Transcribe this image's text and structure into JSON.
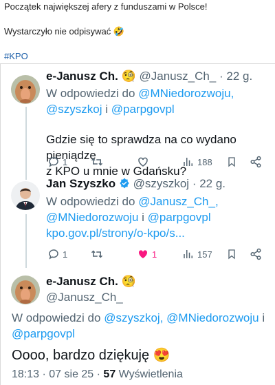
{
  "post": {
    "title": "Początek największej afery z funduszami w Polsce!",
    "line2": "Wystarczyło nie odpisywać",
    "emoji2": "🤣",
    "hashtag": "#KPO"
  },
  "tweet1": {
    "name": "e-Janusz Ch.",
    "name_emoji": "🧐",
    "handle": "@Janusz_Ch_",
    "sep": "·",
    "time": "22 g.",
    "reply_prefix": "W odpowiedzi do",
    "reply_to_1": "@MNiedorozwoju,",
    "reply_to_2": "@szyszkoj",
    "reply_and": "i",
    "reply_to_3": "@parpgovpl",
    "text_line1": "Gdzie się to sprawdza na co wydano pieniądze",
    "text_line2": "z KPO u mnie w Gdańsku?",
    "replies": "1",
    "likes": "",
    "views": "188"
  },
  "tweet2": {
    "name": "Jan Szyszko",
    "handle": "@szyszkoj",
    "sep": "·",
    "time": "22 g.",
    "reply_prefix": "W odpowiedzi do",
    "reply_to_1": "@Janusz_Ch_,",
    "reply_to_2": "@MNiedorozwoju",
    "reply_and": "i",
    "reply_to_3": "@parpgovpl",
    "link": "kpo.gov.pl/strony/o-kpo/s...",
    "replies": "1",
    "likes": "1",
    "views": "157"
  },
  "tweet3": {
    "name": "e-Janusz Ch.",
    "name_emoji": "🧐",
    "handle": "@Janusz_Ch_",
    "reply_prefix": "W odpowiedzi do",
    "reply_to_1": "@szyszkoj,",
    "reply_to_2": "@MNiedorozwoju",
    "reply_and": "i",
    "reply_to_3": "@parpgovpl",
    "text": "Oooo, bardzo dziękuję",
    "text_emoji": "😍",
    "time": "18:13",
    "date": "07 sie 25",
    "views_count": "57",
    "views_label": "Wyświetlenia"
  },
  "colors": {
    "link": "#1d9bf0",
    "muted": "#536471",
    "like": "#f91880",
    "verified": "#1d9bf0"
  }
}
